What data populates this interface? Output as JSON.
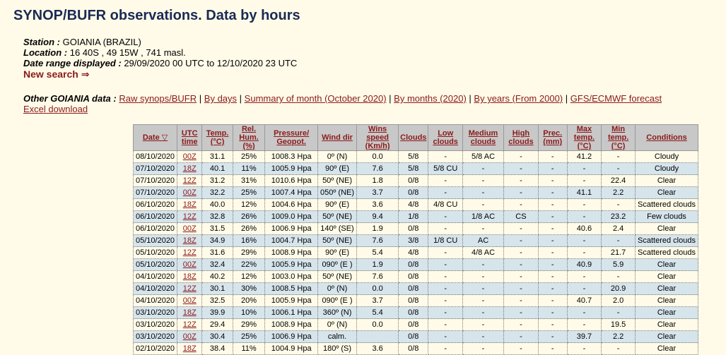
{
  "page": {
    "title": "SYNOP/BUFR observations. Data by hours"
  },
  "station": {
    "station_label": "Station :",
    "station_value": " GOIANIA (BRAZIL)",
    "location_label": "Location :",
    "location_value": " 16 40S , 49 15W , 741 masl.",
    "range_label": "Date range displayed :",
    "range_value": " 29/09/2020 00 UTC to 12/10/2020 23 UTC",
    "new_search": "New search ⇒"
  },
  "other": {
    "label": "Other GOIANIA data :",
    "links": [
      "Raw synops/BUFR",
      "By days",
      "Summary of month (October 2020)",
      "By months (2020)",
      "By years (From 2000)",
      "GFS/ECMWF forecast"
    ],
    "excel": "Excel download"
  },
  "table": {
    "headers": [
      "Date ▽",
      "UTC time",
      "Temp. (°C)",
      "Rel. Hum. (%)",
      "Pressure/ Geopot.",
      "Wind dir",
      "Wins speed (Km/h)",
      "Clouds",
      "Low clouds",
      "Medium clouds",
      "High clouds",
      "Prec. (mm)",
      "Max temp. (°C)",
      "Min temp. (°C)",
      "Conditions"
    ],
    "rows": [
      [
        "08/10/2020",
        "00Z",
        "31.1",
        "25%",
        "1008.3 Hpa",
        "0º (N)",
        "0.0",
        "5/8",
        "-",
        "5/8 AC",
        "-",
        "-",
        "41.2",
        "-",
        "Cloudy"
      ],
      [
        "07/10/2020",
        "18Z",
        "40.1",
        "11%",
        "1005.9 Hpa",
        "90º (E)",
        "7.6",
        "5/8",
        "5/8 CU",
        "-",
        "-",
        "-",
        "-",
        "-",
        "Cloudy"
      ],
      [
        "07/10/2020",
        "12Z",
        "31.2",
        "31%",
        "1010.6 Hpa",
        "50º (NE)",
        "1.8",
        "0/8",
        "-",
        "-",
        "-",
        "-",
        "-",
        "22.4",
        "Clear"
      ],
      [
        "07/10/2020",
        "00Z",
        "32.2",
        "25%",
        "1007.4 Hpa",
        "050º (NE)",
        "3.7",
        "0/8",
        "-",
        "-",
        "-",
        "-",
        "41.1",
        "2.2",
        "Clear"
      ],
      [
        "06/10/2020",
        "18Z",
        "40.0",
        "12%",
        "1004.6 Hpa",
        "90º (E)",
        "3.6",
        "4/8",
        "4/8 CU",
        "-",
        "-",
        "-",
        "-",
        "-",
        "Scattered clouds"
      ],
      [
        "06/10/2020",
        "12Z",
        "32.8",
        "26%",
        "1009.0 Hpa",
        "50º (NE)",
        "9.4",
        "1/8",
        "-",
        "1/8 AC",
        "CS",
        "-",
        "-",
        "23.2",
        "Few clouds"
      ],
      [
        "06/10/2020",
        "00Z",
        "31.5",
        "26%",
        "1006.9 Hpa",
        "140º (SE)",
        "1.9",
        "0/8",
        "-",
        "-",
        "-",
        "-",
        "40.6",
        "2.4",
        "Clear"
      ],
      [
        "05/10/2020",
        "18Z",
        "34.9",
        "16%",
        "1004.7 Hpa",
        "50º (NE)",
        "7.6",
        "3/8",
        "1/8 CU",
        "AC",
        "-",
        "-",
        "-",
        "-",
        "Scattered clouds"
      ],
      [
        "05/10/2020",
        "12Z",
        "31.6",
        "29%",
        "1008.9 Hpa",
        "90º (E)",
        "5.4",
        "4/8",
        "-",
        "4/8 AC",
        "-",
        "-",
        "-",
        "21.7",
        "Scattered clouds"
      ],
      [
        "05/10/2020",
        "00Z",
        "32.4",
        "22%",
        "1005.9 Hpa",
        "090º (E )",
        "1.9",
        "0/8",
        "-",
        "-",
        "-",
        "-",
        "40.9",
        "5.9",
        "Clear"
      ],
      [
        "04/10/2020",
        "18Z",
        "40.2",
        "12%",
        "1003.0 Hpa",
        "50º (NE)",
        "7.6",
        "0/8",
        "-",
        "-",
        "-",
        "-",
        "-",
        "-",
        "Clear"
      ],
      [
        "04/10/2020",
        "12Z",
        "30.1",
        "30%",
        "1008.5 Hpa",
        "0º (N)",
        "0.0",
        "0/8",
        "-",
        "-",
        "-",
        "-",
        "-",
        "20.9",
        "Clear"
      ],
      [
        "04/10/2020",
        "00Z",
        "32.5",
        "20%",
        "1005.9 Hpa",
        "090º (E )",
        "3.7",
        "0/8",
        "-",
        "-",
        "-",
        "-",
        "40.7",
        "2.0",
        "Clear"
      ],
      [
        "03/10/2020",
        "18Z",
        "39.9",
        "10%",
        "1006.1 Hpa",
        "360º (N)",
        "5.4",
        "0/8",
        "-",
        "-",
        "-",
        "-",
        "-",
        "-",
        "Clear"
      ],
      [
        "03/10/2020",
        "12Z",
        "29.4",
        "29%",
        "1008.9 Hpa",
        "0º (N)",
        "0.0",
        "0/8",
        "-",
        "-",
        "-",
        "-",
        "-",
        "19.5",
        "Clear"
      ],
      [
        "03/10/2020",
        "00Z",
        "30.4",
        "25%",
        "1006.9 Hpa",
        "calm.",
        "",
        "0/8",
        "-",
        "-",
        "-",
        "-",
        "39.7",
        "2.2",
        "Clear"
      ],
      [
        "02/10/2020",
        "18Z",
        "38.4",
        "11%",
        "1004.9 Hpa",
        "180º (S)",
        "3.6",
        "0/8",
        "-",
        "-",
        "-",
        "-",
        "-",
        "-",
        "Clear"
      ]
    ]
  }
}
